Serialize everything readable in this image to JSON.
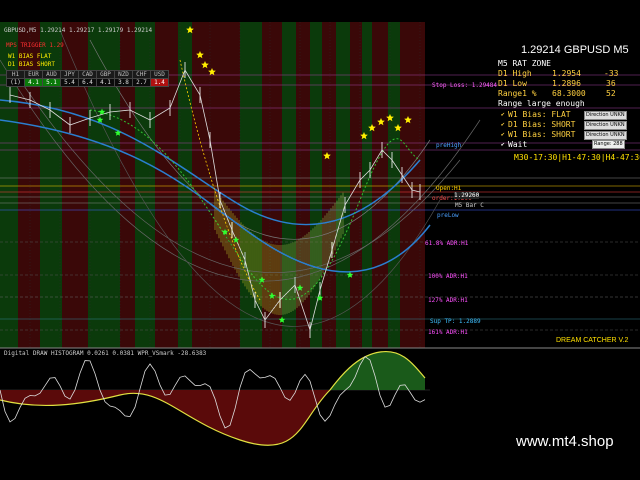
{
  "header": {
    "symbol_line": "GBPUSD,M5  1.29214 1.29217 1.29179 1.29214",
    "price_title": "1.29214 GBPUSD M5",
    "trigger_label": "MPS TRIGGER 1.29"
  },
  "top_left_bias": {
    "w1": "W1 BIAS FLAT",
    "d1": "D1 BIAS SHORT"
  },
  "currency_strength": {
    "headers": [
      "EUR",
      "AUD",
      "JPY",
      "CAD",
      "GBP",
      "NZD",
      "CHF",
      "USD"
    ],
    "row_label": "(1)",
    "tf_label": "H1",
    "values": [
      "4.1",
      "5.1",
      "5.4",
      "6.4",
      "4.1",
      "3.8",
      "2.7",
      "1.4"
    ]
  },
  "info_panel": {
    "zone": "M5  RAT ZONE",
    "rows": [
      {
        "label": "D1 High",
        "value": "1.2954",
        "pips": "-33"
      },
      {
        "label": "D1 Low",
        "value": "1.2896",
        "pips": "36"
      },
      {
        "label": "Range1 %",
        "value": "68.3000",
        "pips": "52"
      }
    ],
    "range_msg": "Range large enough",
    "biases": [
      {
        "label": "W1 Bias: FLAT",
        "button": "Direction UNKN"
      },
      {
        "label": "D1 Bias: SHORT",
        "button": "Direction UNKN"
      },
      {
        "label": "W1 Bias: SHORT",
        "button": "Direction UNKN"
      }
    ],
    "wait": "Wait",
    "range_box": "Range: 288",
    "timers": "M30-17:30|H1-47:30|H4-47:30"
  },
  "levels": {
    "stop_loss": "Stop Loss: 1.29484",
    "pre_high": "preHigh",
    "open_h1": "Open:H1",
    "order": "order:1.290",
    "preLow": "preLow",
    "adr_61": "61.8% ADR:H1",
    "adr_100": "100% ADR:H1",
    "adr_127": "127% ADR:H1",
    "sup_tp": "Sup TP: 1.2889",
    "adr_161": "161% ADR:H1",
    "box_val": "1.29260",
    "small_label": "M5 Bar C"
  },
  "footer": {
    "product": "DREAM CATCHER V.2",
    "indicator_label": "Digital DRAW HISTOGRAM 0.0261 0.0381  WPR_VSmark -28.6383",
    "watermark": "www.mt4.shop"
  },
  "colors": {
    "bull_band": "#0b3a0b",
    "bear_band": "#3a0808",
    "ma_blue": "#2a7fd0",
    "panel_text": "#ffffff",
    "level_magenta": "#ff40ff",
    "accent_yellow": "#ffd000"
  }
}
